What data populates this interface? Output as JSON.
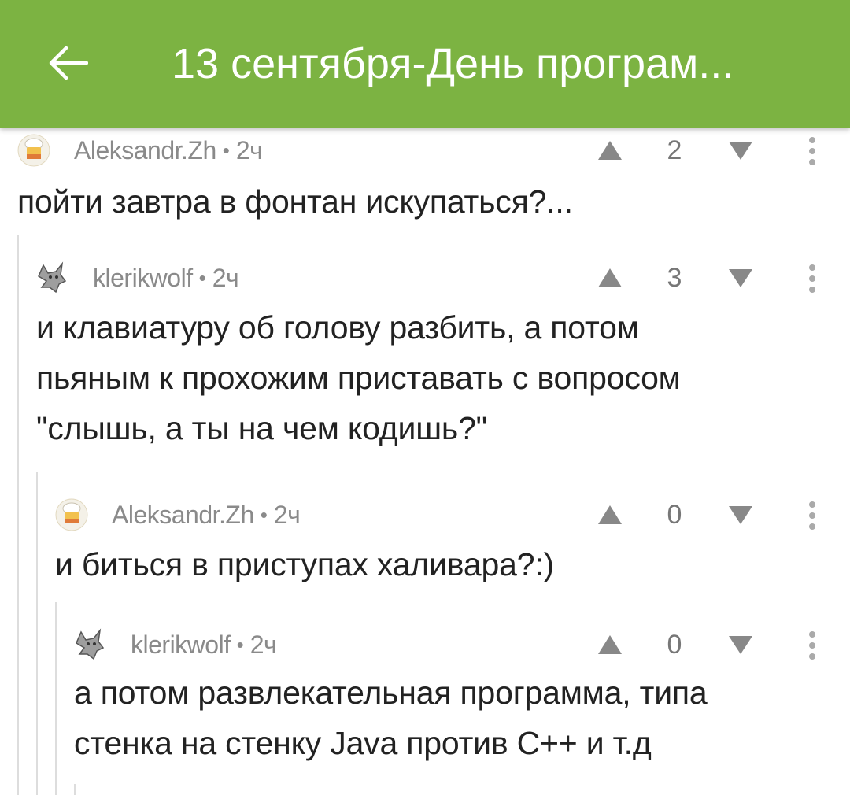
{
  "header": {
    "title": "13 сентября-День програм...",
    "back_icon": "arrow-left-icon",
    "background": "#7cb342"
  },
  "comments": [
    {
      "author": "Aleksandr.Zh",
      "time": "2ч",
      "rating": "2",
      "avatar": "chef-icon",
      "text": "пойти завтра в фонтан искупаться?..."
    },
    {
      "author": "klerikwolf",
      "time": "2ч",
      "rating": "3",
      "avatar": "wolf-icon",
      "text": "и клавиатуру об голову разбить, а потом\nпьяным к прохожим приставать с вопросом\n\"слышь, а ты на чем кодишь?\""
    },
    {
      "author": "Aleksandr.Zh",
      "time": "2ч",
      "rating": "0",
      "avatar": "chef-icon",
      "text": "и биться в приступах халивара?:)"
    },
    {
      "author": "klerikwolf",
      "time": "2ч",
      "rating": "0",
      "avatar": "wolf-icon",
      "text": "а потом развлекательная программа, типа\nстенка на стенку Java против С++ и т.д"
    }
  ],
  "meta_separator": "•",
  "icons": {
    "upvote": "triangle-up-icon",
    "downvote": "chevron-down-icon",
    "more": "more-vertical-icon"
  },
  "colors": {
    "vote_icon": "#888888",
    "meta_text": "#8a8a8a",
    "thread_line": "#dddddd"
  }
}
